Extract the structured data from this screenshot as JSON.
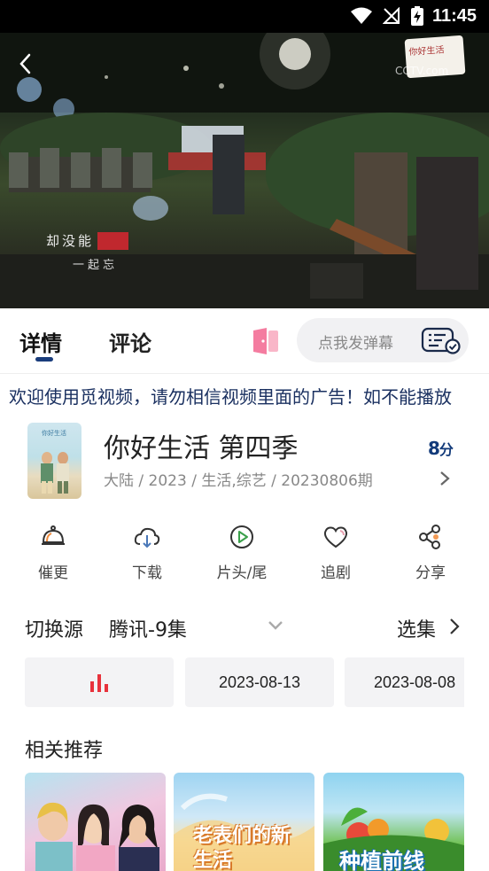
{
  "status_bar": {
    "time": "11:45"
  },
  "video": {
    "subtitle_line1": "却没能",
    "subtitle_line2": "一起忘",
    "watermark": "CCTV.com",
    "logo_text": "你好生活"
  },
  "tabs": {
    "detail": "详情",
    "comment": "评论"
  },
  "danmaku": {
    "placeholder": "点我发弹幕"
  },
  "notice": "欢迎使用觅视频，请勿相信视频里面的广告！如不能播放",
  "show": {
    "title": "你好生活 第四季",
    "meta": "大陆 / 2023 / 生活,综艺 / 20230806期",
    "score": "8",
    "score_unit": "分"
  },
  "actions": [
    {
      "label": "催更",
      "icon": "bell-icon"
    },
    {
      "label": "下载",
      "icon": "cloud-download-icon"
    },
    {
      "label": "片头/尾",
      "icon": "play-circle-icon"
    },
    {
      "label": "追剧",
      "icon": "heart-icon"
    },
    {
      "label": "分享",
      "icon": "share-icon"
    }
  ],
  "source": {
    "label": "切换源",
    "value": "腾讯-9集",
    "episodes_label": "选集"
  },
  "episodes": [
    {
      "label": "",
      "playing": true
    },
    {
      "label": "2023-08-13"
    },
    {
      "label": "2023-08-08"
    }
  ],
  "related": {
    "title": "相关推荐",
    "items": [
      {
        "text": ""
      },
      {
        "text": "老表们的新生活"
      },
      {
        "text": "种植前线"
      }
    ]
  },
  "colors": {
    "accent_red": "#e8323c",
    "brand_navy": "#1a3d7c",
    "notice_text": "#1a3060"
  }
}
